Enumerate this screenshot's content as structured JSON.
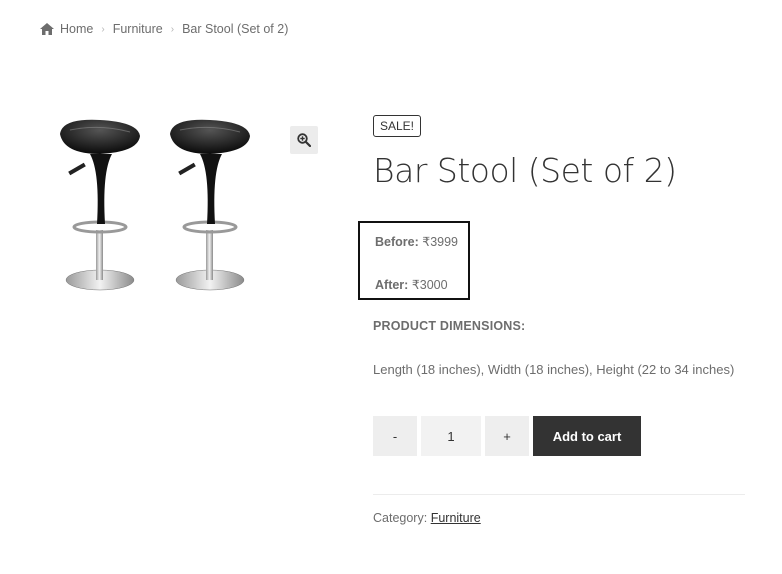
{
  "breadcrumb": {
    "home": "Home",
    "category": "Furniture",
    "current": "Bar Stool (Set of 2)"
  },
  "product": {
    "sale_badge": "SALE!",
    "title": "Bar Stool (Set of 2)",
    "price_before_label": "Before:",
    "price_before": "₹3999",
    "price_after_label": "After:",
    "price_after": "₹3000",
    "dimensions_heading": "PRODUCT DIMENSIONS:",
    "dimensions_text": "Length (18 inches), Width (18 inches), Height (22 to 34 inches)",
    "image_icon": "bar-stools-image",
    "zoom_icon": "zoom-in-icon"
  },
  "cart": {
    "minus_label": "-",
    "quantity": "1",
    "plus_label": "+",
    "add_label": "Add to cart"
  },
  "meta": {
    "category_label": "Category:",
    "category_link": "Furniture"
  },
  "colors": {
    "text": "#6d6d6d",
    "heading": "#333333",
    "button_dark": "#333333",
    "qty_bg": "#eeeeee"
  }
}
